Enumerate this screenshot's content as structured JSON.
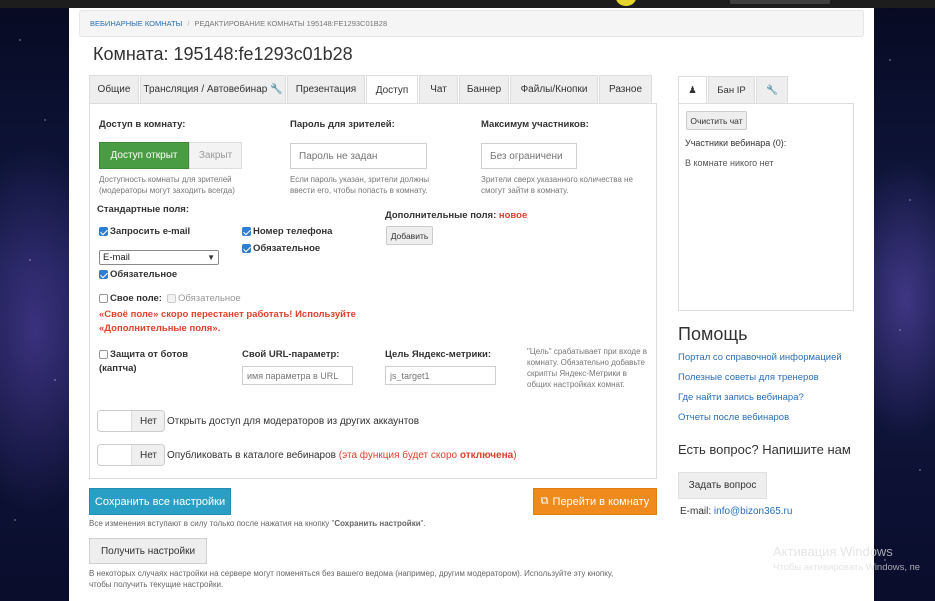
{
  "breadcrumb": {
    "link": "Вебинарные комнаты",
    "separator": "/",
    "current": "Редактирование комнаты 195148:fe1293c01b28"
  },
  "page_title": "Комната: 195148:fe1293c01b28",
  "tabs": [
    {
      "label": "Общие",
      "active": false
    },
    {
      "label": "Трансляция / Автовебинар",
      "active": false,
      "icon": "wrench-icon"
    },
    {
      "label": "Презентация",
      "active": false
    },
    {
      "label": "Доступ",
      "active": true
    },
    {
      "label": "Чат",
      "active": false
    },
    {
      "label": "Баннер",
      "active": false
    },
    {
      "label": "Файлы/Кнопки",
      "active": false
    },
    {
      "label": "Разное",
      "active": false
    }
  ],
  "access": {
    "label": "Доступ в комнату:",
    "open_label": "Доступ открыт",
    "closed_label": "Закрыт",
    "hint": "Доступность комнаты для зрителей (модераторы могут заходить всегда)"
  },
  "password": {
    "label": "Пароль для зрителей:",
    "placeholder": "Пароль не задан",
    "hint": "Если пароль указан, зрители должны ввести его, чтобы попасть в комнату."
  },
  "max_participants": {
    "label": "Максимум участников:",
    "placeholder": "Без ограничени",
    "hint": "Зрители сверх указанного количества не смогут зайти в комнату."
  },
  "standard_fields": {
    "label": "Стандартные поля:",
    "request_email": "Запросить e-mail",
    "email_select": "E-mail",
    "required": "Обязательное",
    "phone": "Номер телефона",
    "phone_required": "Обязательное"
  },
  "extra_fields": {
    "label": "Дополнительные поля:",
    "badge": "новое",
    "add_button": "Добавить"
  },
  "own_field": {
    "label": "Свое поле:",
    "required": "Обязательное",
    "warning_line1": "«Своё поле» скоро перестанет работать! Используйте",
    "warning_line2": "«Дополнительные поля»."
  },
  "bot_protection": {
    "label_line1": "Защита от ботов",
    "label_line2": "(каптча)"
  },
  "url_param": {
    "label": "Свой URL-параметр:",
    "placeholder": "имя параметра в URL"
  },
  "yandex_goal": {
    "label": "Цель Яндекс-метрики:",
    "placeholder": "js_target1",
    "hint": "\"Цель\" срабатывает при входе в комнату. Обязательно добавьте скрипты Яндекс-Метрики в общих настройках комнат."
  },
  "moderators_toggle": {
    "value": "Нет",
    "label": "Открыть доступ для модераторов из других аккаунтов"
  },
  "catalog_toggle": {
    "value": "Нет",
    "label": "Опубликовать в каталоге вебинаров",
    "note_prefix": "(эта функция будет скоро ",
    "note_bold": "отключена",
    "note_suffix": ")"
  },
  "save_button": "Сохранить все настройки",
  "go_button": "Перейти в комнату",
  "save_note_prefix": "Все изменения вступают в силу только после нажатия на кнопку \"",
  "save_note_bold": "Сохранить настройки",
  "save_note_suffix": "\".",
  "get_button": "Получить настройки",
  "get_note_line1": "В некоторых случаях настройки на сервере могут поменяться без вашего ведома (например, другим модератором). Используйте эту кнопку,",
  "get_note_line2": "чтобы получить текущие настройки.",
  "sidebar": {
    "tabs": [
      {
        "icon": "user-icon",
        "label": "",
        "active": true
      },
      {
        "label": "Бан IP",
        "active": false
      },
      {
        "icon": "wrench-icon",
        "label": "",
        "active": false
      }
    ],
    "clear_chat": "Очистить чат",
    "participants": "Участники вебинара (0):",
    "empty": "В комнате никого нет",
    "help_title": "Помощь",
    "help_links": [
      "Портал со справочной информацией",
      "Полезные советы для тренеров",
      "Где найти запись вебинара?",
      "Отчеты после вебинаров"
    ],
    "question_title": "Есть вопрос? Напишите нам",
    "ask_button": "Задать вопрос",
    "email_label": "E-mail:",
    "email_value": "info@bizon365.ru"
  },
  "watermark": {
    "line1": "Активация Windows",
    "line2": "Чтобы активировать Windows, пе"
  },
  "colors": {
    "primary_green": "#4a9c44",
    "save_blue": "#2a9fc6",
    "go_orange": "#f08a1d",
    "warning_red": "#e0412c",
    "link_blue": "#2a6fb6"
  }
}
